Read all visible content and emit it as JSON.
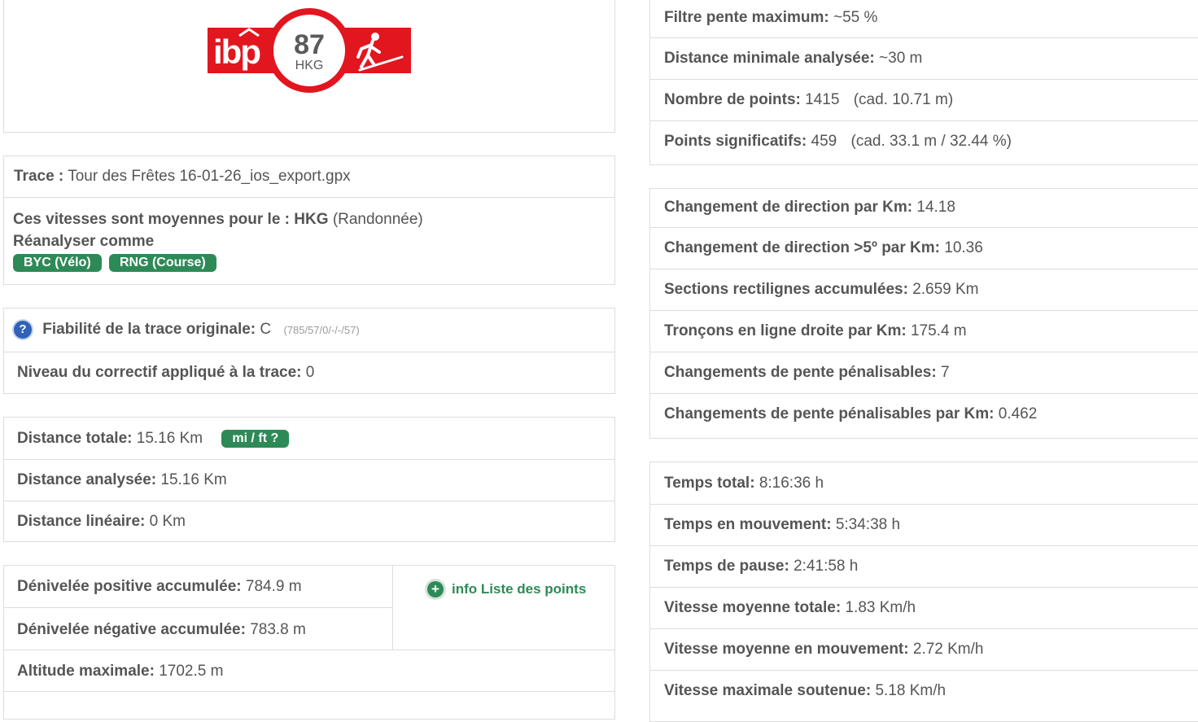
{
  "logo": {
    "brand": "ibp",
    "score": "87",
    "code": "HKG",
    "brand_color": "#e2161e"
  },
  "trace": {
    "label": "Trace :",
    "value": "Tour des Frêtes 16-01-26_ios_export.gpx"
  },
  "speeds": {
    "text": "Ces vitesses sont moyennes pour le :",
    "mode": "HKG",
    "mode_name": "(Randonnée)",
    "reanalyze_label": "Réanalyser comme",
    "buttons": [
      "BYC (Vélo)",
      "RNG (Course)"
    ]
  },
  "reliability": {
    "label": "Fiabilité de la trace originale:",
    "value": "C",
    "code": "(785/57/0/-/-/57)",
    "correction_label": "Niveau du correctif appliqué à la trace:",
    "correction_value": "0"
  },
  "distance": {
    "total_label": "Distance totale:",
    "total_value": "15.16 Km",
    "unit_button": "mi / ft ?",
    "analyzed_label": "Distance analysée:",
    "analyzed_value": "15.16 Km",
    "linear_label": "Distance linéaire:",
    "linear_value": "0 Km"
  },
  "elevation": {
    "pos_label": "Dénivelée positive accumulée:",
    "pos_value": "784.9 m",
    "neg_label": "Dénivelée négative accumulée:",
    "neg_value": "783.8 m",
    "max_label": "Altitude maximale:",
    "max_value": "1702.5 m",
    "info_link": "info Liste des points"
  },
  "filters": {
    "slope_label": "Filtre pente maximum:",
    "slope_value": "~55 %",
    "mindist_label": "Distance minimale analysée:",
    "mindist_value": "~30 m",
    "points_label": "Nombre de points:",
    "points_value": "1415",
    "points_cad": "(cad. 10.71 m)",
    "sig_label": "Points significatifs:",
    "sig_value": "459",
    "sig_cad": "(cad. 33.1 m / 32.44 %)"
  },
  "direction": {
    "dir_label": "Changement de direction par Km:",
    "dir_value": "14.18",
    "dir5_label": "Changement de direction >5º par Km:",
    "dir5_value": "10.36",
    "rect_label": "Sections rectilignes accumulées:",
    "rect_value": "2.659 Km",
    "straight_label": "Tronçons en ligne droite par Km:",
    "straight_value": "175.4 m",
    "slope_label": "Changements de pente pénalisables:",
    "slope_value": "7",
    "slopekm_label": "Changements de pente pénalisables par Km:",
    "slopekm_value": "0.462"
  },
  "times": {
    "total_label": "Temps total:",
    "total_value": "8:16:36 h",
    "moving_label": "Temps en mouvement:",
    "moving_value": "5:34:38 h",
    "pause_label": "Temps de pause:",
    "pause_value": "2:41:58 h",
    "avg_label": "Vitesse moyenne totale:",
    "avg_value": "1.83 Km/h",
    "avgmove_label": "Vitesse moyenne en mouvement:",
    "avgmove_value": "2.72 Km/h",
    "max_label": "Vitesse maximale soutenue:",
    "max_value": "5.18 Km/h"
  }
}
